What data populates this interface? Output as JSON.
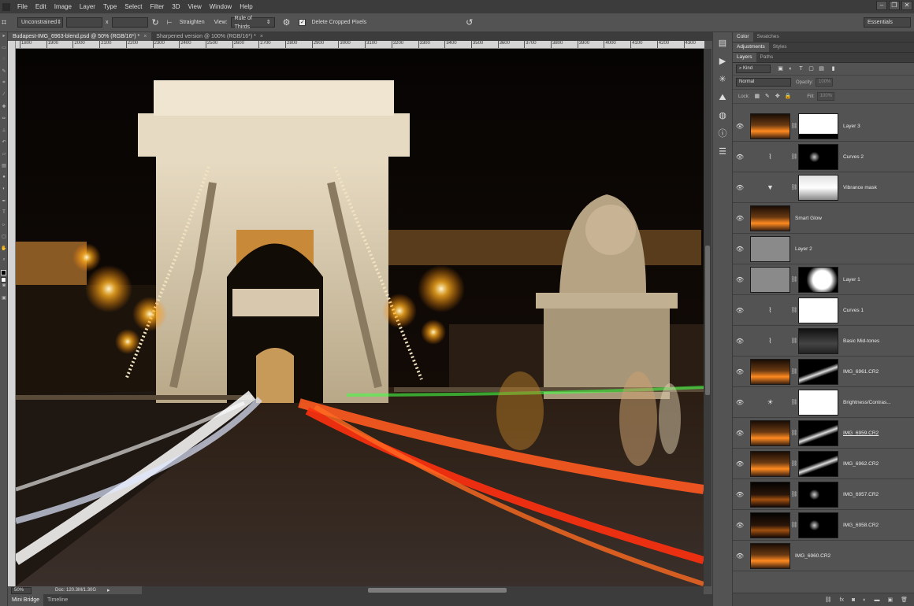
{
  "menubar": {
    "items": [
      "File",
      "Edit",
      "Image",
      "Layer",
      "Type",
      "Select",
      "Filter",
      "3D",
      "View",
      "Window",
      "Help"
    ],
    "window_controls": [
      "–",
      "❐",
      "✕"
    ]
  },
  "options": {
    "ratio_select": "Unconstrained",
    "times_sign": "x",
    "straighten_label": "Straighten",
    "view_label": "View:",
    "view_select": "Rule of Thirds",
    "delete_cropped_label": "Delete Cropped Pixels",
    "workspace": "Essentials"
  },
  "doctabs": [
    {
      "label": "Budapest-IMG_6963-blend.psd @ 50% (RGB/16*) *",
      "close": "×"
    },
    {
      "label": "Sharpened version @ 100% (RGB/16*) *",
      "close": "×"
    }
  ],
  "ruler_ticks": [
    "1800",
    "1900",
    "2000",
    "2100",
    "2200",
    "2300",
    "2400",
    "2500",
    "2600",
    "2700",
    "2800",
    "2900",
    "3000",
    "3100",
    "3200",
    "3300",
    "3400",
    "3500",
    "3600",
    "3700",
    "3800",
    "3900",
    "4000",
    "4100",
    "4200",
    "4300",
    "4400"
  ],
  "status": {
    "zoom": "50%",
    "doc": "Doc: 120.3M/1.30G",
    "arrow": "▸"
  },
  "bottom_tabs": [
    "Mini Bridge",
    "Timeline"
  ],
  "panels": {
    "top_tabs": [
      "Color",
      "Swatches"
    ],
    "mid_tabs": [
      "Adjustments",
      "Styles"
    ],
    "layer_tabs": [
      "Layers",
      "Paths"
    ],
    "filter_kind": "Kind",
    "blend_mode": "Normal",
    "opacity_label": "Opacity:",
    "opacity_value": "100%",
    "lock_label": "Lock:",
    "fill_label": "Fill:",
    "fill_value": "100%"
  },
  "layers": [
    {
      "name": "Layer 3",
      "thumb": "photo",
      "mask": "white-top",
      "underline": false
    },
    {
      "name": "Curves 2",
      "thumb": "curves-icon",
      "mask": "black-dot",
      "underline": false
    },
    {
      "name": "Vibrance mask",
      "thumb": "vibrance-icon",
      "mask": "bw-scene",
      "underline": false
    },
    {
      "name": "Smart Glow",
      "thumb": "photo",
      "mask": "",
      "underline": false
    },
    {
      "name": "Layer 2",
      "thumb": "gray-dots",
      "mask": "",
      "underline": false
    },
    {
      "name": "Layer 1",
      "thumb": "gray",
      "mask": "bw-bridge",
      "underline": false
    },
    {
      "name": "Curves 1",
      "thumb": "curves-icon",
      "mask": "white",
      "underline": false
    },
    {
      "name": "Basic Mid-tones",
      "thumb": "curves-icon",
      "mask": "dark-scene",
      "underline": false
    },
    {
      "name": "IMG_6961.CR2",
      "thumb": "photo",
      "mask": "black-streak",
      "underline": false
    },
    {
      "name": "Brightness/Contras...",
      "thumb": "brightness-icon",
      "mask": "white",
      "underline": false
    },
    {
      "name": "IMG_6959.CR2",
      "thumb": "photo",
      "mask": "black-streak",
      "underline": true
    },
    {
      "name": "IMG_6962.CR2",
      "thumb": "photo",
      "mask": "black-streak",
      "underline": false
    },
    {
      "name": "IMG_6957.CR2",
      "thumb": "photo-dark",
      "mask": "black-dot",
      "underline": false
    },
    {
      "name": "IMG_6958.CR2",
      "thumb": "photo-dark",
      "mask": "black-dot",
      "underline": false
    },
    {
      "name": "IMG_6960.CR2",
      "thumb": "photo",
      "mask": "",
      "underline": false
    }
  ],
  "footer_icons": [
    "link-icon",
    "fx-icon",
    "mask-icon",
    "adjustment-icon",
    "group-icon",
    "new-layer-icon",
    "trash-icon"
  ],
  "colors": {
    "menubar": "#3c3c3c",
    "panel": "#535353",
    "sky": "#0c0805",
    "light_trail_red": "#ff3b10",
    "light_trail_white": "#ffffff",
    "lamp_glow": "#ffb020"
  }
}
